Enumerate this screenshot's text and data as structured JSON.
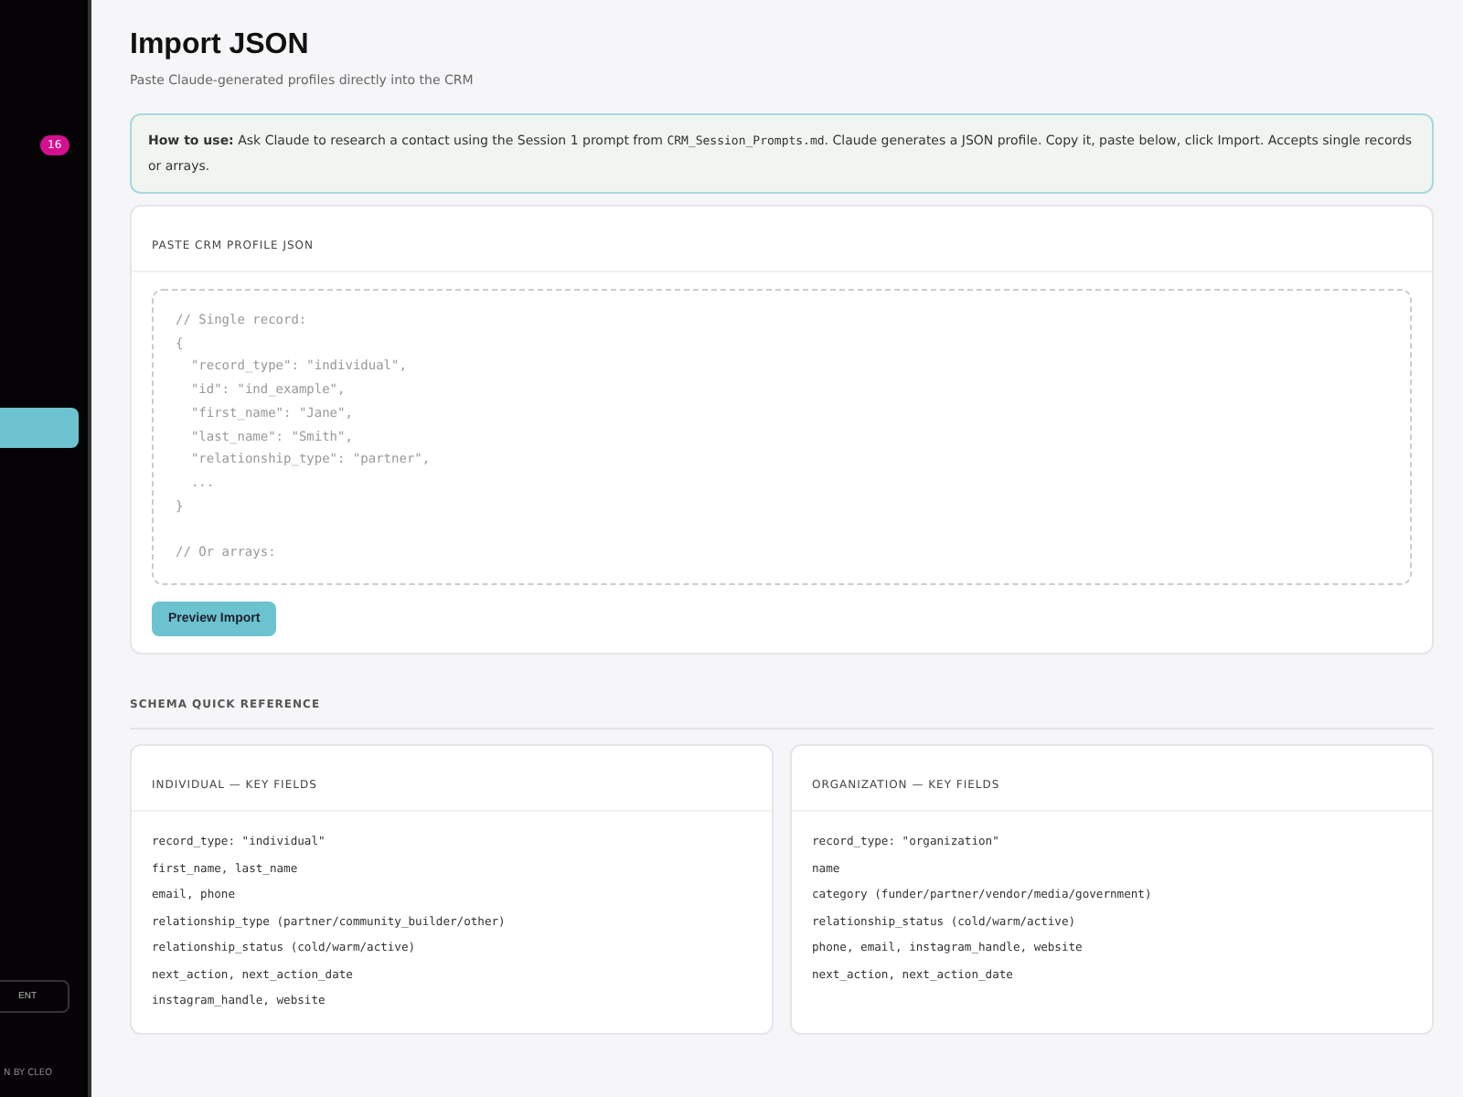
{
  "sidebar": {
    "badge": "16",
    "items": [
      {
        "selected": true
      }
    ],
    "button": "ENT",
    "footer": "N BY CLEO"
  },
  "page": {
    "title": "Import JSON",
    "subtitle": "Paste Claude-generated profiles directly into the CRM"
  },
  "info": {
    "lead": "How to use:",
    "text": "Ask Claude to research a contact using the Session 1 prompt from ",
    "file": "CRM_Session_Prompts.md",
    "rest": ". Claude generates a JSON profile. Copy it, paste below, click Import. Accepts single records or arrays."
  },
  "paste_card": {
    "title": "PASTE CRM PROFILE JSON",
    "placeholder": "// Single record:\n{\n  \"record_type\": \"individual\",\n  \"id\": \"ind_example\",\n  \"first_name\": \"Jane\",\n  \"last_name\": \"Smith\",\n  \"relationship_type\": \"partner\",\n  ...\n}\n\n// Or arrays:",
    "button": "Preview Import"
  },
  "schema": {
    "title": "SCHEMA QUICK REFERENCE",
    "cards": [
      {
        "title": "INDIVIDUAL — KEY FIELDS",
        "lines": [
          "record_type: \"individual\"",
          "first_name, last_name",
          "email, phone",
          "relationship_type (partner/community_builder/other)",
          "relationship_status (cold/warm/active)",
          "next_action, next_action_date",
          "instagram_handle, website"
        ]
      },
      {
        "title": "ORGANIZATION — KEY FIELDS",
        "lines": [
          "record_type: \"organization\"",
          "name",
          "category (funder/partner/vendor/media/government)",
          "relationship_status (cold/warm/active)",
          "phone, email, instagram_handle, website",
          "next_action, next_action_date"
        ]
      }
    ]
  }
}
